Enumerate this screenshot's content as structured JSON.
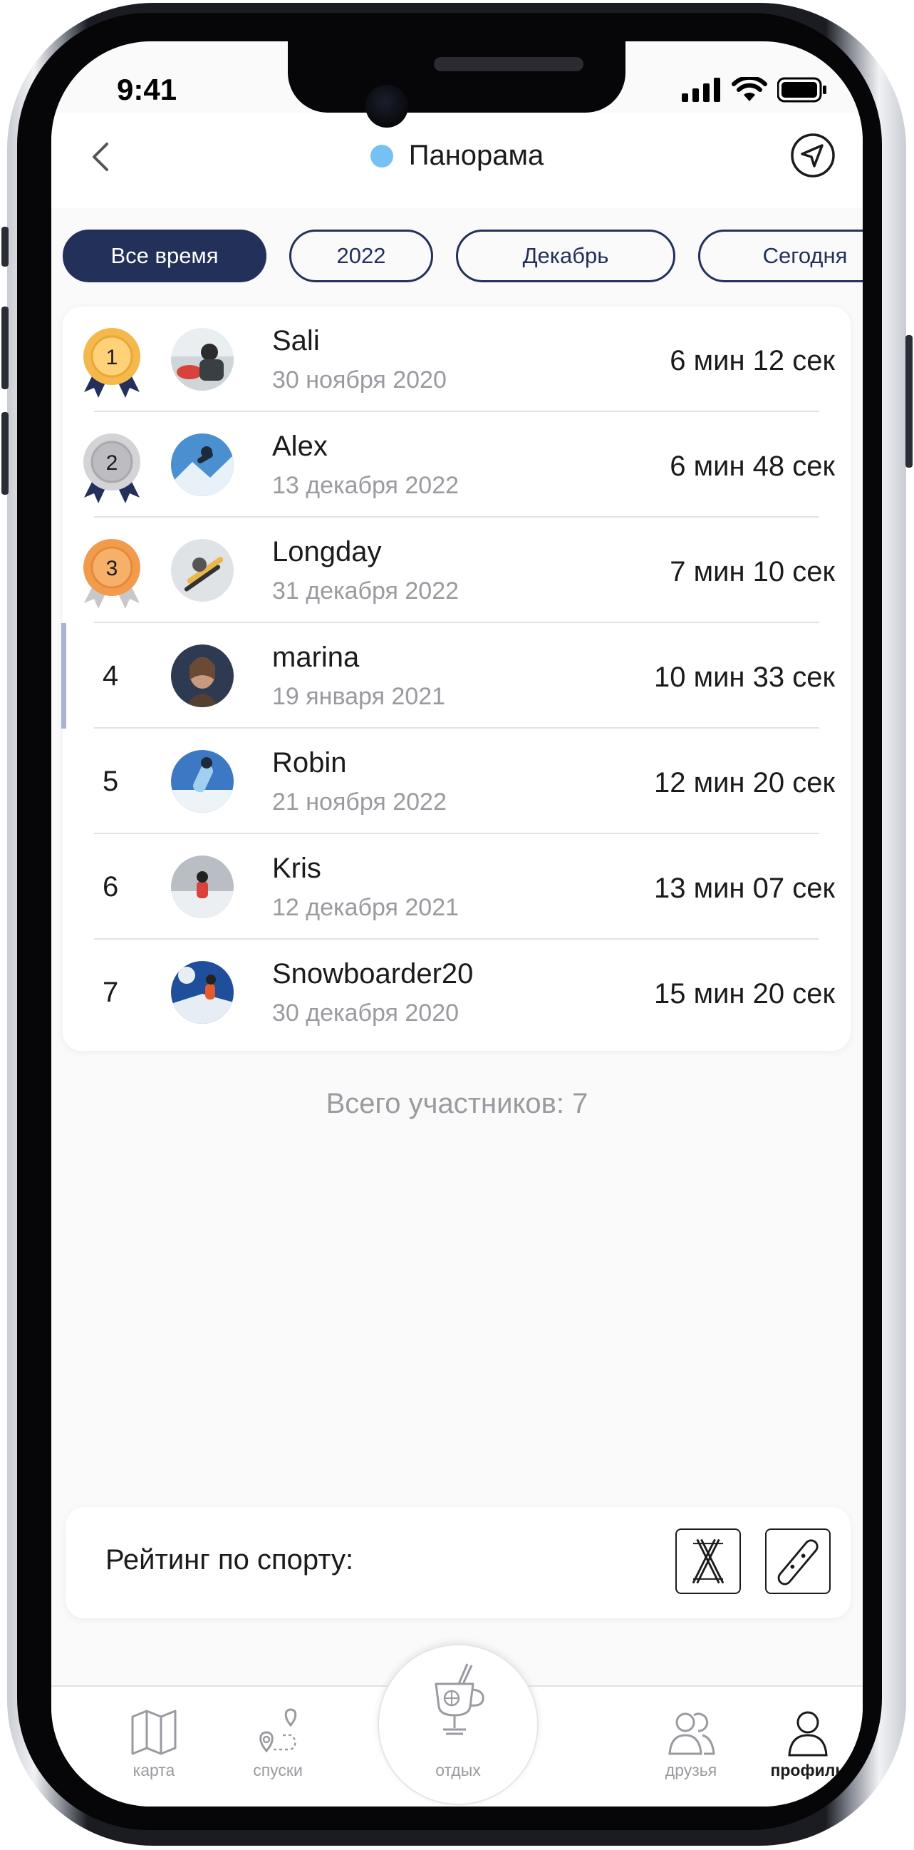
{
  "status": {
    "time": "9:41"
  },
  "header": {
    "title": "Панорама"
  },
  "filters": [
    "Все время",
    "2022",
    "Декабрь",
    "Сегодня"
  ],
  "leaderboard": [
    {
      "rank": "1",
      "name": "Sali",
      "date": "30 ноября 2020",
      "time": "6 мин 12 сек",
      "medal": "gold"
    },
    {
      "rank": "2",
      "name": "Alex",
      "date": "13 декабря 2022",
      "time": "6 мин 48 сек",
      "medal": "silver"
    },
    {
      "rank": "3",
      "name": "Longday",
      "date": "31 декабря 2022",
      "time": "7 мин 10 сек",
      "medal": "bronze"
    },
    {
      "rank": "4",
      "name": "marina",
      "date": "19 января 2021",
      "time": "10 мин 33 сек",
      "medal": ""
    },
    {
      "rank": "5",
      "name": "Robin",
      "date": "21 ноября 2022",
      "time": "12 мин 20 сек",
      "medal": ""
    },
    {
      "rank": "6",
      "name": "Kris",
      "date": "12 декабря 2021",
      "time": "13 мин 07 сек",
      "medal": ""
    },
    {
      "rank": "7",
      "name": "Snowboarder20",
      "date": "30 декабря 2020",
      "time": "15 мин 20 сек",
      "medal": ""
    }
  ],
  "total": "Всего участников: 7",
  "sport": {
    "label": "Рейтинг по спорту:",
    "buttons": [
      "ski-icon",
      "snowboard-icon"
    ]
  },
  "tabs": {
    "map": "карта",
    "runs": "спуски",
    "rest": "отдых",
    "friends": "друзья",
    "profile": "профиль"
  },
  "colors": {
    "accent": "#23305a",
    "dot": "#76c1f4",
    "gold": "#f5b84a",
    "silver": "#c9c9cc",
    "bronze": "#f29b4c"
  }
}
